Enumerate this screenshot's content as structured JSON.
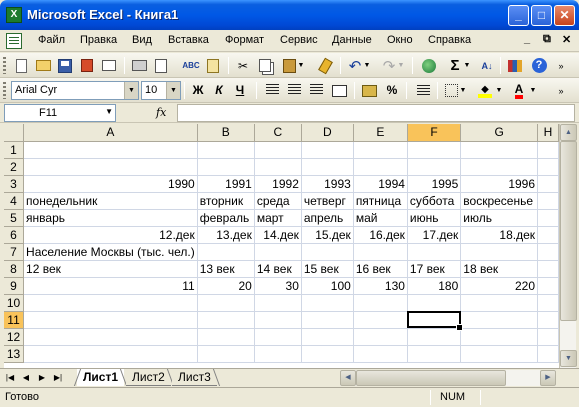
{
  "window": {
    "title": "Microsoft Excel - Книга1",
    "app_icon_text": "X",
    "minimize_symbol": "_",
    "maximize_symbol": "□",
    "close_symbol": "✕"
  },
  "menu": {
    "items": [
      "Файл",
      "Правка",
      "Вид",
      "Вставка",
      "Формат",
      "Сервис",
      "Данные",
      "Окно",
      "Справка"
    ],
    "doc_controls": [
      "_",
      "⧉",
      "✕"
    ]
  },
  "toolbar": {
    "undo_symbol": "↶",
    "redo_symbol": "↷",
    "sum_symbol": "Σ",
    "sort_symbol": "А↓",
    "help_symbol": "?"
  },
  "format_toolbar": {
    "font_name": "Arial Cyr",
    "font_size": "10",
    "bold": "Ж",
    "italic": "К",
    "underline": "Ч",
    "percent": "%",
    "font_color_letter": "А"
  },
  "formula_bar": {
    "name_box": "F11",
    "fx_label": "fx",
    "formula_value": ""
  },
  "colors": {
    "active_header": "#f9c35a",
    "gridline": "#d0d7e5",
    "titlebar": "#0058e6"
  },
  "sheet": {
    "column_headers": [
      "A",
      "B",
      "C",
      "D",
      "E",
      "F",
      "G",
      "H"
    ],
    "active_column": "F",
    "active_row": 11,
    "selected_cell": "F11",
    "rows": [
      {
        "n": "1",
        "cells": [
          "",
          "",
          "",
          "",
          "",
          "",
          "",
          ""
        ]
      },
      {
        "n": "2",
        "cells": [
          "",
          "",
          "",
          "",
          "",
          "",
          "",
          ""
        ]
      },
      {
        "n": "3",
        "cells": [
          "1990",
          "1991",
          "1992",
          "1993",
          "1994",
          "1995",
          "1996",
          ""
        ]
      },
      {
        "n": "4",
        "cells": [
          "понедельник",
          "вторник",
          "среда",
          "четверг",
          "пятница",
          "суббота",
          "воскресенье",
          ""
        ]
      },
      {
        "n": "5",
        "cells": [
          "январь",
          "февраль",
          "март",
          "апрель",
          "май",
          "июнь",
          "июль",
          ""
        ]
      },
      {
        "n": "6",
        "cells": [
          "12.дек",
          "13.дек",
          "14.дек",
          "15.дек",
          "16.дек",
          "17.дек",
          "18.дек",
          ""
        ]
      },
      {
        "n": "7",
        "cells": [
          "Население Москвы (тыс. чел.)",
          "",
          "",
          "",
          "",
          "",
          "",
          ""
        ]
      },
      {
        "n": "8",
        "cells": [
          "12 век",
          "13 век",
          "14 век",
          "15 век",
          "16 век",
          "17 век",
          "18 век",
          ""
        ]
      },
      {
        "n": "9",
        "cells": [
          "11",
          "20",
          "30",
          "100",
          "130",
          "180",
          "220",
          ""
        ]
      },
      {
        "n": "10",
        "cells": [
          "",
          "",
          "",
          "",
          "",
          "",
          "",
          ""
        ]
      },
      {
        "n": "11",
        "cells": [
          "",
          "",
          "",
          "",
          "",
          "",
          "",
          ""
        ]
      },
      {
        "n": "12",
        "cells": [
          "",
          "",
          "",
          "",
          "",
          "",
          "",
          ""
        ]
      },
      {
        "n": "13",
        "cells": [
          "",
          "",
          "",
          "",
          "",
          "",
          "",
          ""
        ]
      }
    ],
    "numeric_rows": [
      "3",
      "6",
      "9"
    ]
  },
  "tabs": {
    "nav_symbols": [
      "|◀",
      "◀",
      "▶",
      "▶|"
    ],
    "sheets": [
      "Лист1",
      "Лист2",
      "Лист3"
    ],
    "active": "Лист1"
  },
  "status": {
    "text": "Готово",
    "num": "NUM"
  }
}
